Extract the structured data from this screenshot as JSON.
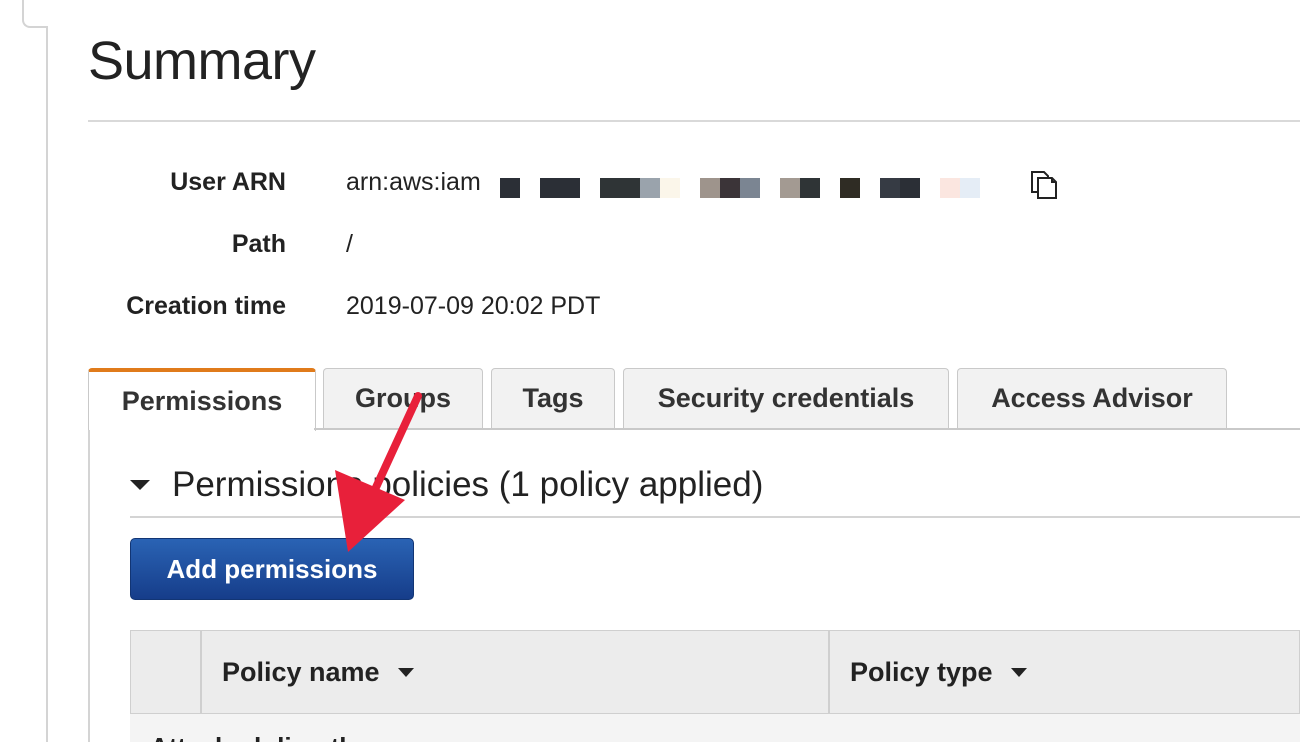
{
  "page": {
    "title": "Summary"
  },
  "summary": {
    "user_arn": {
      "label": "User ARN",
      "value": "arn:aws:iam"
    },
    "path": {
      "label": "Path",
      "value": "/"
    },
    "creation_time": {
      "label": "Creation time",
      "value": "2019-07-09 20:02 PDT"
    }
  },
  "tabs": [
    {
      "label": "Permissions",
      "active": true
    },
    {
      "label": "Groups",
      "active": false
    },
    {
      "label": "Tags",
      "active": false
    },
    {
      "label": "Security credentials",
      "active": false
    },
    {
      "label": "Access Advisor",
      "active": false
    }
  ],
  "permissions": {
    "section_title": "Permissions policies (1 policy applied)",
    "add_button": "Add permissions",
    "table": {
      "columns": [
        "Policy name",
        "Policy type"
      ],
      "group_label": "Attached directly"
    }
  },
  "colors": {
    "active_tab_accent": "#e07b1b",
    "primary_button": "#1f4f9e",
    "annotation_arrow": "#e8203a"
  },
  "icons": {
    "copy": "copy-icon",
    "section_caret": "caret-down-icon",
    "sort": "sort-down-icon"
  }
}
